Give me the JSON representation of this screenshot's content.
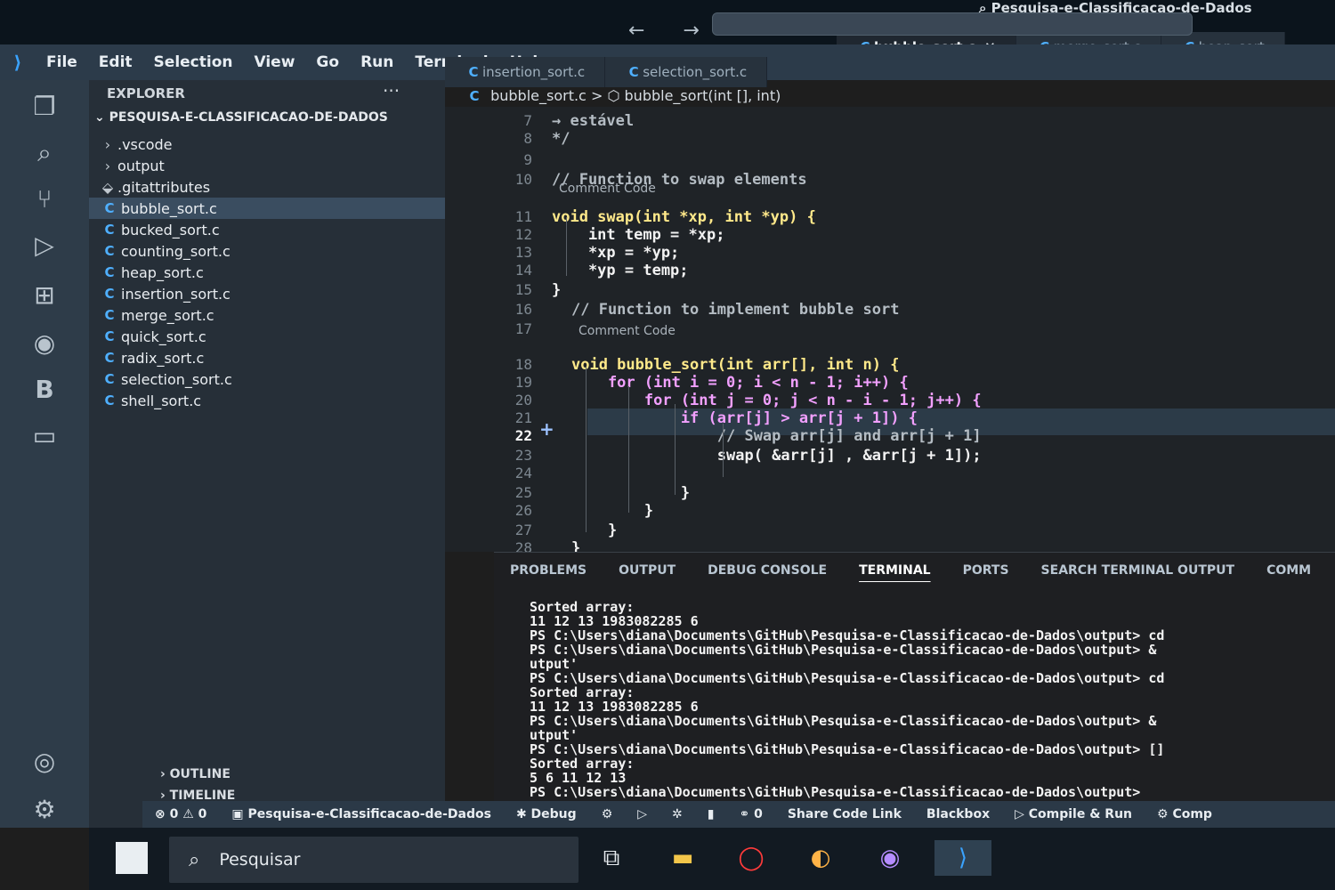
{
  "window": {
    "search_title": "Pesquisa-e-Classificacao-de-Dados",
    "nav_arrows": "← →"
  },
  "menu": [
    "File",
    "Edit",
    "Selection",
    "View",
    "Go",
    "Run",
    "Terminal",
    "Help"
  ],
  "sidebar": {
    "title": "EXPLORER",
    "more": "···",
    "folder": "PESQUISA-E-CLASSIFICACAO-DE-DADOS",
    "items": [
      {
        "label": ".vscode",
        "kind": "folder"
      },
      {
        "label": "output",
        "kind": "folder"
      },
      {
        "label": ".gitattributes",
        "kind": "gitfile"
      },
      {
        "label": "bubble_sort.c",
        "kind": "c",
        "selected": true
      },
      {
        "label": "bucked_sort.c",
        "kind": "c"
      },
      {
        "label": "counting_sort.c",
        "kind": "c"
      },
      {
        "label": "heap_sort.c",
        "kind": "c"
      },
      {
        "label": "insertion_sort.c",
        "kind": "c"
      },
      {
        "label": "merge_sort.c",
        "kind": "c"
      },
      {
        "label": "quick_sort.c",
        "kind": "c"
      },
      {
        "label": "radix_sort.c",
        "kind": "c"
      },
      {
        "label": "selection_sort.c",
        "kind": "c"
      },
      {
        "label": "shell_sort.c",
        "kind": "c"
      }
    ],
    "outline": "OUTLINE",
    "timeline": "TIMELINE",
    "c_badge": "C"
  },
  "tabs": {
    "row1": [
      {
        "label": "bubble_sort.c",
        "active": true,
        "close": "✕"
      },
      {
        "label": "merge_sort.c"
      },
      {
        "label": "heap_sort"
      }
    ],
    "row2": [
      {
        "label": "insertion_sort.c"
      },
      {
        "label": "selection_sort.c"
      }
    ]
  },
  "breadcrumb": {
    "file": "bubble_sort.c",
    "sep": ">",
    "symbol": "bubble_sort(int [], int)"
  },
  "editor": {
    "lines": [
      {
        "n": "7",
        "text": "→ estável"
      },
      {
        "n": "8",
        "text": "*/"
      },
      {
        "n": "9",
        "text": ""
      },
      {
        "n": "10",
        "text": "// Function to swap elements"
      },
      {
        "n": "11",
        "text": "void swap(int *xp, int *yp) {"
      },
      {
        "n": "12",
        "text": "    int temp = *xp;"
      },
      {
        "n": "13",
        "text": "    *xp = *yp;"
      },
      {
        "n": "14",
        "text": "    *yp = temp;"
      },
      {
        "n": "15",
        "text": "}"
      },
      {
        "n": "16",
        "text": "// Function to implement bubble sort"
      },
      {
        "n": "17",
        "text": ""
      },
      {
        "n": "18",
        "text": "void bubble_sort(int arr[], int n) {"
      },
      {
        "n": "19",
        "text": "    for (int i = 0; i < n - 1; i++) {"
      },
      {
        "n": "20",
        "text": "        for (int j = 0; j < n - i - 1; j++) {"
      },
      {
        "n": "21",
        "text": "            if (arr[j] > arr[j + 1]) {"
      },
      {
        "n": "22",
        "text": "                // Swap arr[j] and arr[j + 1]"
      },
      {
        "n": "23",
        "text": "                swap( &arr[j] , &arr[j + 1]);"
      },
      {
        "n": "24",
        "text": ""
      },
      {
        "n": "25",
        "text": "            }"
      },
      {
        "n": "26",
        "text": "        }"
      },
      {
        "n": "27",
        "text": "    }"
      },
      {
        "n": "28",
        "text": "}"
      }
    ],
    "comment_code_label": "Comment Code",
    "current_line": "22",
    "add_icon": "+"
  },
  "panel": {
    "tabs": [
      "PROBLEMS",
      "OUTPUT",
      "DEBUG CONSOLE",
      "TERMINAL",
      "PORTS",
      "SEARCH TERMINAL OUTPUT",
      "COMM"
    ],
    "active_tab": "TERMINAL",
    "terminal": [
      "Sorted array:",
      "11 12 13 1983082285 6",
      "PS C:\\Users\\diana\\Documents\\GitHub\\Pesquisa-e-Classificacao-de-Dados\\output> cd",
      "PS C:\\Users\\diana\\Documents\\GitHub\\Pesquisa-e-Classificacao-de-Dados\\output> &",
      "utput'",
      "PS C:\\Users\\diana\\Documents\\GitHub\\Pesquisa-e-Classificacao-de-Dados\\output> cd",
      "Sorted array:",
      "11 12 13 1983082285 6",
      "PS C:\\Users\\diana\\Documents\\GitHub\\Pesquisa-e-Classificacao-de-Dados\\output> &",
      "utput'",
      "PS C:\\Users\\diana\\Documents\\GitHub\\Pesquisa-e-Classificacao-de-Dados\\output> []",
      "Sorted array:",
      "5 6 11 12 13",
      "PS C:\\Users\\diana\\Documents\\GitHub\\Pesquisa-e-Classificacao-de-Dados\\output>"
    ]
  },
  "statusbar": {
    "problems": "⊗ 0 ⚠ 0",
    "project": "Pesquisa-e-Classificacao-de-Dados",
    "debug": "Debug",
    "share": "Share Code Link",
    "blackbox": "Blackbox",
    "compile": "Compile & Run",
    "comp": "Comp",
    "zero": "0"
  },
  "taskbar": {
    "search_placeholder": "Pesquisar"
  },
  "colors": {
    "accent": "#3aa3ff",
    "keyword": "#f2a0ff",
    "type": "#ffd166",
    "selected_row": "#3a4d60"
  }
}
